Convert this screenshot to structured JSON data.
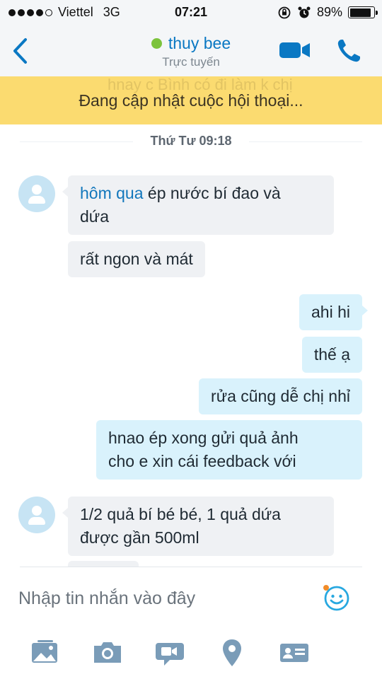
{
  "status_bar": {
    "carrier": "Viettel",
    "network": "3G",
    "time": "07:21",
    "battery_percent": "89%",
    "battery_level": 0.89,
    "signal_bars": 4
  },
  "header": {
    "contact_name": "thuy bee",
    "contact_status": "Trực tuyến",
    "presence_color": "#7cc33c",
    "accent_color": "#0a78c3"
  },
  "banner": {
    "ghost_text": "hnay c Bình có đi làm k chị",
    "text": "Đang cập nhật cuộc hội thoại...",
    "color": "#fbdb70"
  },
  "chat": {
    "date_separator": "Thứ Tư 09:18",
    "messages": [
      {
        "direction": "in",
        "prefix": "hôm qua",
        "line1_rest": " ép nước bí đao và",
        "line2": "dứa"
      },
      {
        "direction": "in",
        "text": "rất ngon và mát"
      },
      {
        "direction": "out",
        "text": "ahi hi"
      },
      {
        "direction": "out",
        "text": "thế ạ"
      },
      {
        "direction": "out",
        "text": "rửa cũng dễ chị nhỉ"
      },
      {
        "direction": "out",
        "line1": "hnao ép xong gửi quả ảnh",
        "line2": "cho e xin cái feedback với"
      },
      {
        "direction": "in",
        "line1": "1/2 quả bí bé bé, 1 quả dứa",
        "line2": "được gần 500ml"
      }
    ]
  },
  "composer": {
    "placeholder": "Nhập tin nhắn vào đây",
    "tools": [
      "gallery-icon",
      "camera-icon",
      "video-message-icon",
      "location-icon",
      "contact-card-icon"
    ]
  }
}
